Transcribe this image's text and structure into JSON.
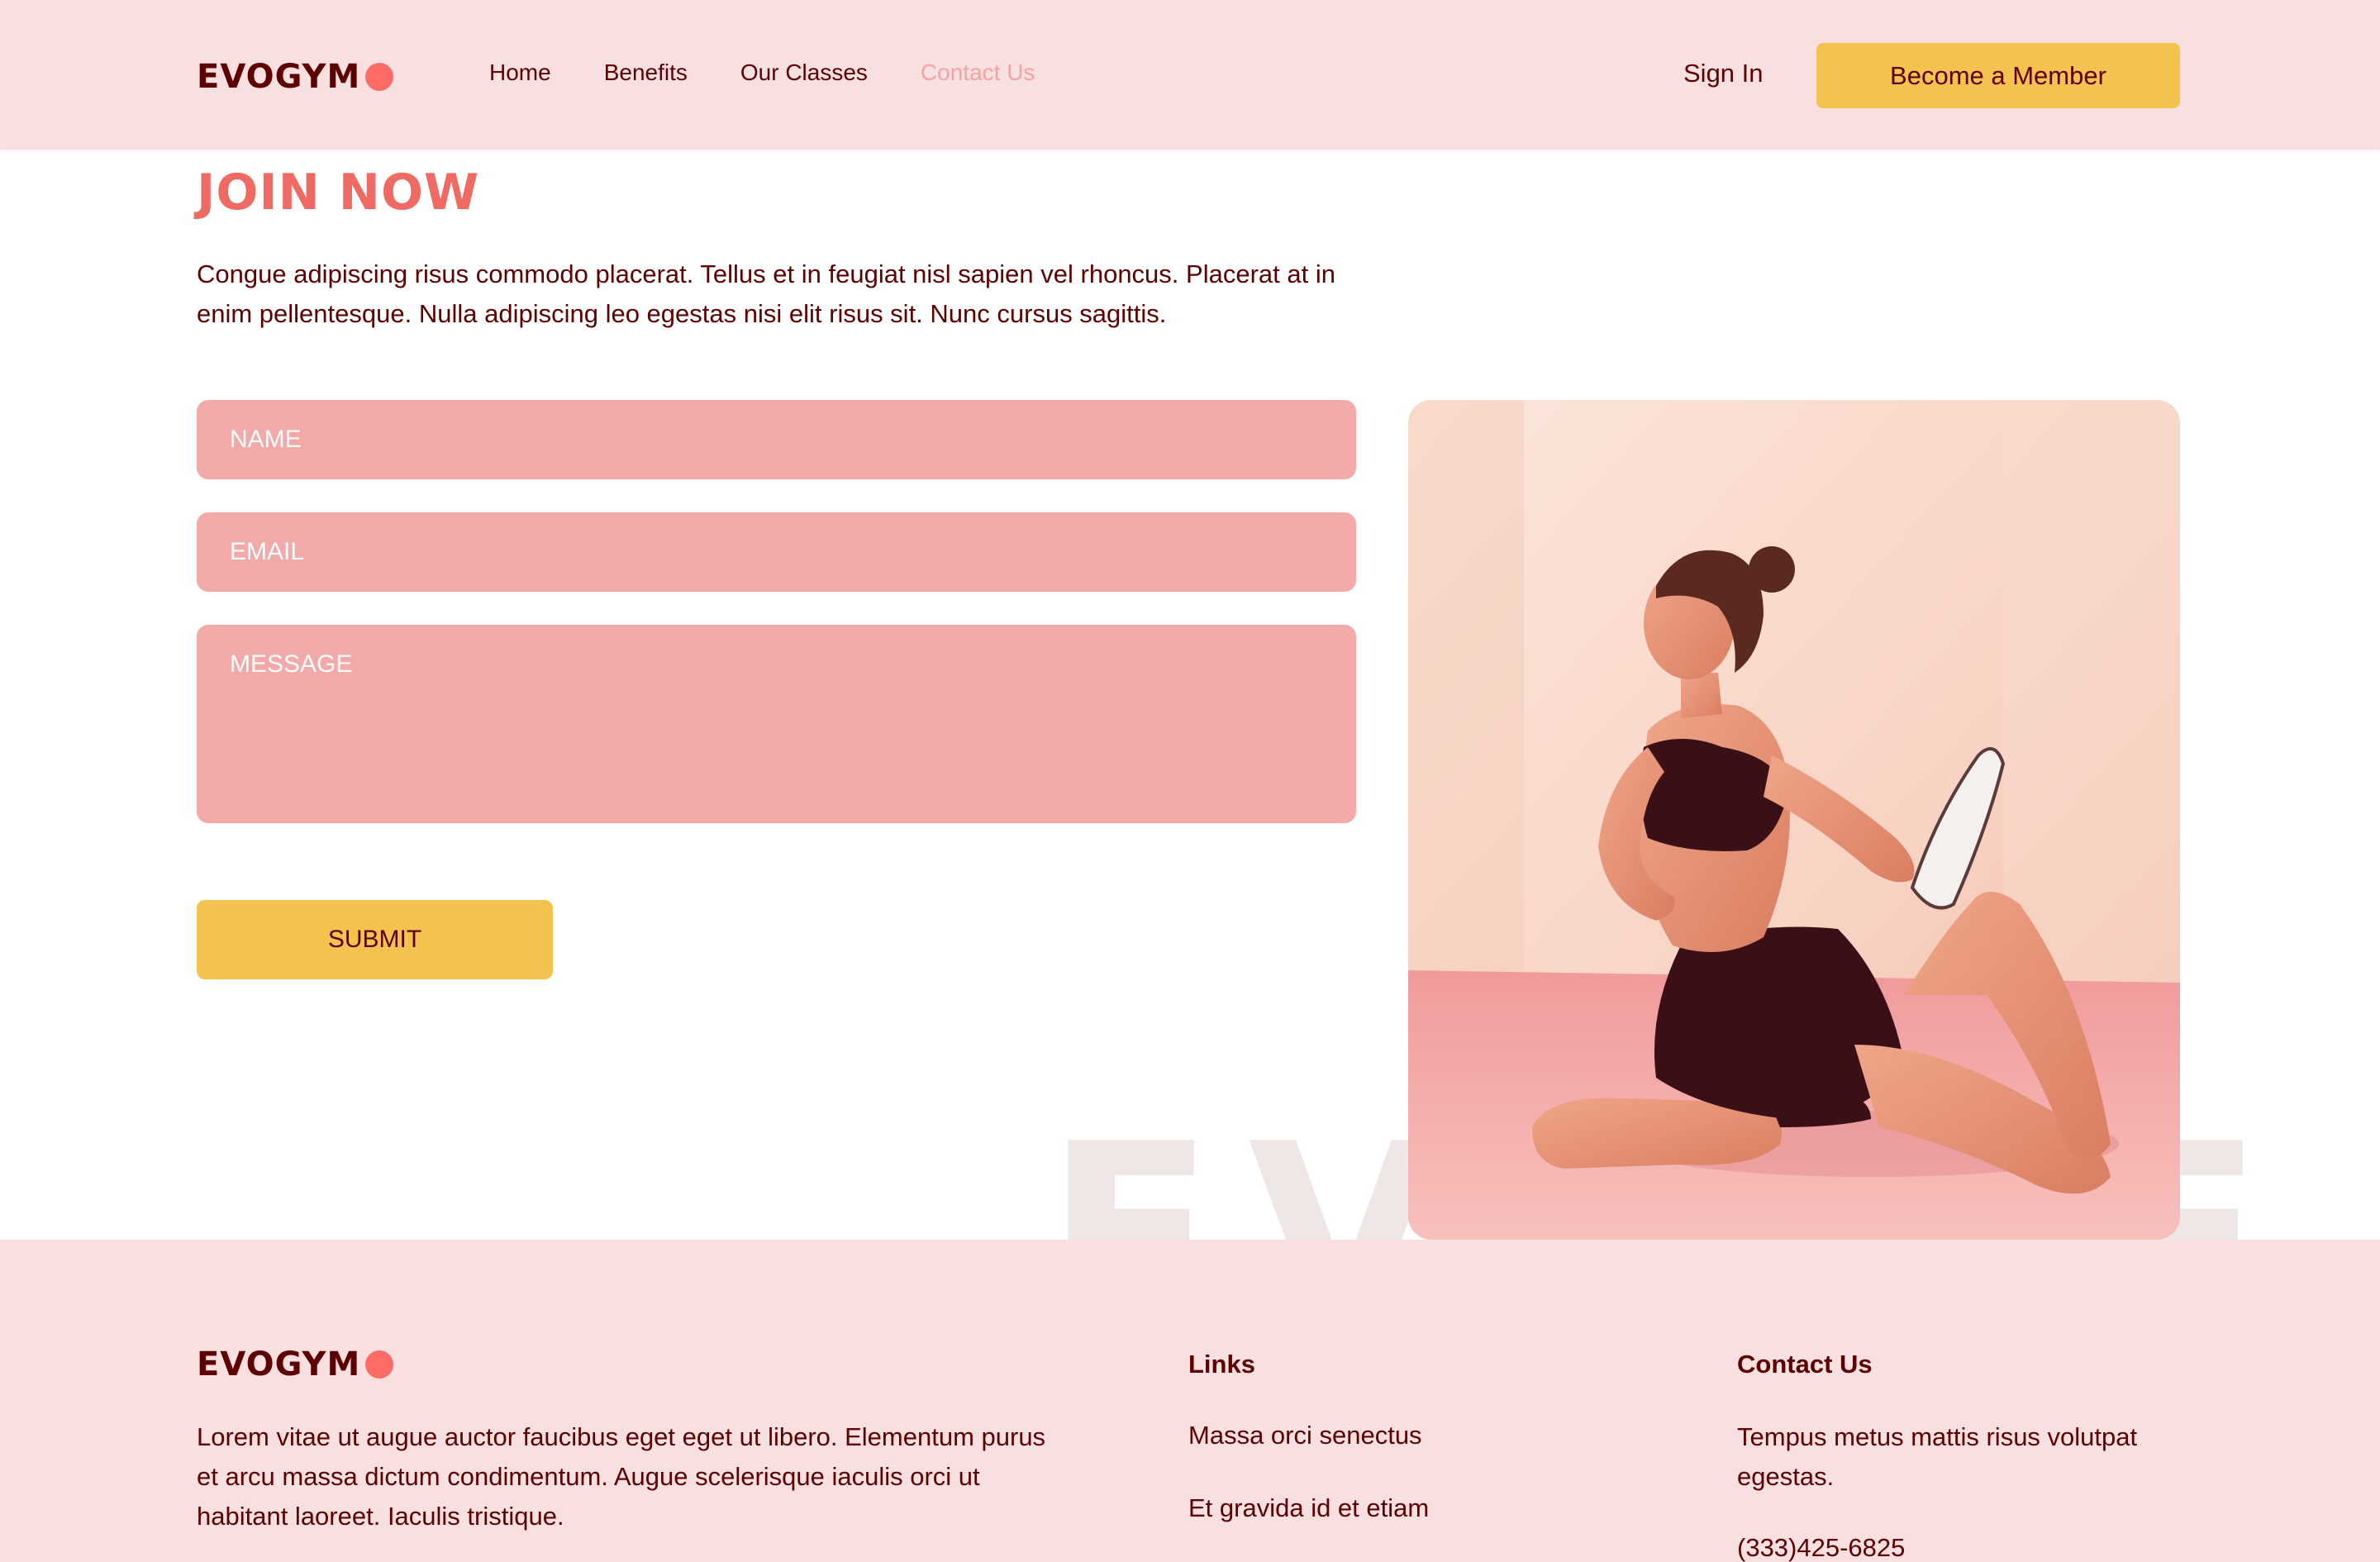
{
  "brand": {
    "name": "EVOGYM",
    "dot_color": "#ff6b66"
  },
  "nav": {
    "links": [
      {
        "label": "Home",
        "active": false
      },
      {
        "label": "Benefits",
        "active": false
      },
      {
        "label": "Our Classes",
        "active": false
      },
      {
        "label": "Contact Us",
        "active": true
      }
    ],
    "sign_in": "Sign In",
    "cta": "Become a Member"
  },
  "join": {
    "title": "JOIN NOW",
    "description": "Congue adipiscing risus commodo placerat. Tellus et in feugiat nisl sapien vel rhoncus. Placerat at in enim pellentesque. Nulla adipiscing leo egestas nisi elit risus sit. Nunc cursus sagittis.",
    "form": {
      "name_placeholder": "NAME",
      "email_placeholder": "EMAIL",
      "message_placeholder": "MESSAGE",
      "submit": "SUBMIT"
    },
    "watermark": "EVOLVE"
  },
  "footer": {
    "description": "Lorem vitae ut augue auctor faucibus eget eget ut libero. Elementum purus et arcu massa dictum condimentum. Augue scelerisque iaculis orci ut habitant laoreet. Iaculis tristique.",
    "links_heading": "Links",
    "links": [
      "Massa orci senectus",
      "Et gravida id et etiam"
    ],
    "contact_heading": "Contact Us",
    "contact_text": "Tempus metus mattis risus volutpat egestas.",
    "phone": "(333)425-6825"
  },
  "colors": {
    "nav_bg": "#f8e0e0",
    "primary": "#5e0000",
    "accent": "#ee6a63",
    "field_bg": "#f2a9a7",
    "button_bg": "#f4c24f"
  }
}
